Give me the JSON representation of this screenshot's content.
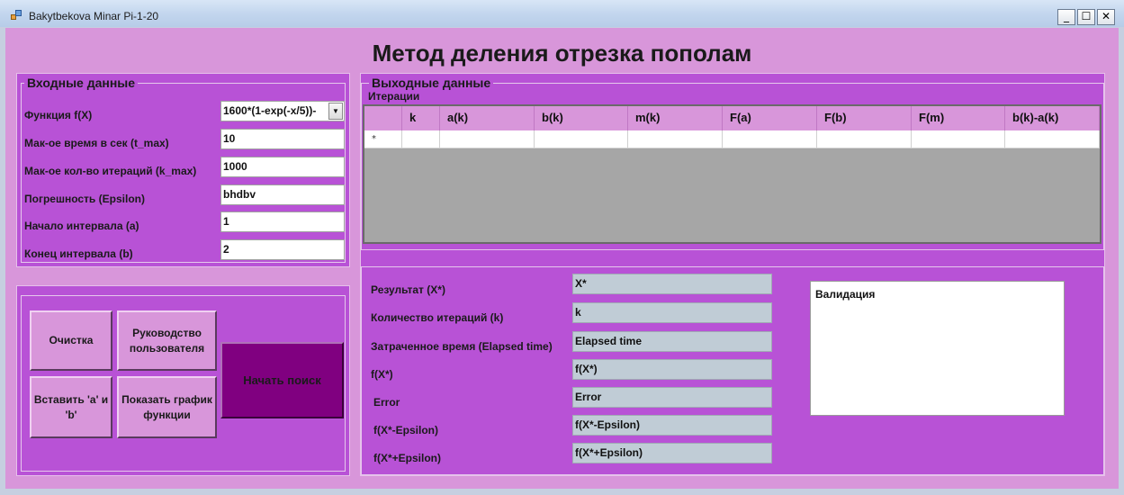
{
  "window": {
    "title": "Bakytbekova Minar Pi-1-20",
    "minimize_glyph": "_",
    "maximize_glyph": "☐",
    "close_glyph": "✕"
  },
  "main_title": "Метод деления отрезка пополам",
  "input_group": {
    "title": "Входные данные",
    "function_label": "Функция f(X)",
    "function_value": "1600*(1-exp(-x/5))-",
    "tmax_label": "Мак-ое время в сек (t_max)",
    "tmax_value": "10",
    "kmax_label": "Мак-ое кол-во итераций (k_max)",
    "kmax_value": "1000",
    "epsilon_label": "Погрешность (Epsilon)",
    "epsilon_value": "bhdbv",
    "a_label": "Начало интервала (a)",
    "a_value": "1",
    "b_label": "Конец интервала (b)",
    "b_value": "2"
  },
  "buttons": {
    "clear": "Очистка",
    "guide": "Руководство пользователя",
    "insert_ab": "Вставить 'a' и 'b'",
    "show_graph": "Показать график функции",
    "start": "Начать поиск"
  },
  "output_group": {
    "title": "Выходные данные",
    "iterations_label": "Итерации",
    "columns": [
      "k",
      "a(k)",
      "b(k)",
      "m(k)",
      "F(a)",
      "F(b)",
      "F(m)",
      "b(k)-a(k)"
    ],
    "new_row_marker": "*"
  },
  "results": {
    "result_label": "Результат (X*)",
    "result_value": "X*",
    "iter_label": "Количество итераций (k)",
    "iter_value": "k",
    "time_label": "Затраченное время (Elapsed time)",
    "time_value": "Elapsed time",
    "fx_label": "f(X*)",
    "fx_value": "f(X*)",
    "error_label": "Error",
    "error_value": "Error",
    "fminus_label": "f(X*-Epsilon)",
    "fminus_value": "f(X*-Epsilon)",
    "fplus_label": "f(X*+Epsilon)",
    "fplus_value": "f(X*+Epsilon)"
  },
  "validation": {
    "label": "Валидация"
  },
  "colors": {
    "form_bg": "#d896da",
    "group_bg": "#b852d6",
    "start_button": "#800080",
    "grid_bg": "#a6a6a6"
  }
}
